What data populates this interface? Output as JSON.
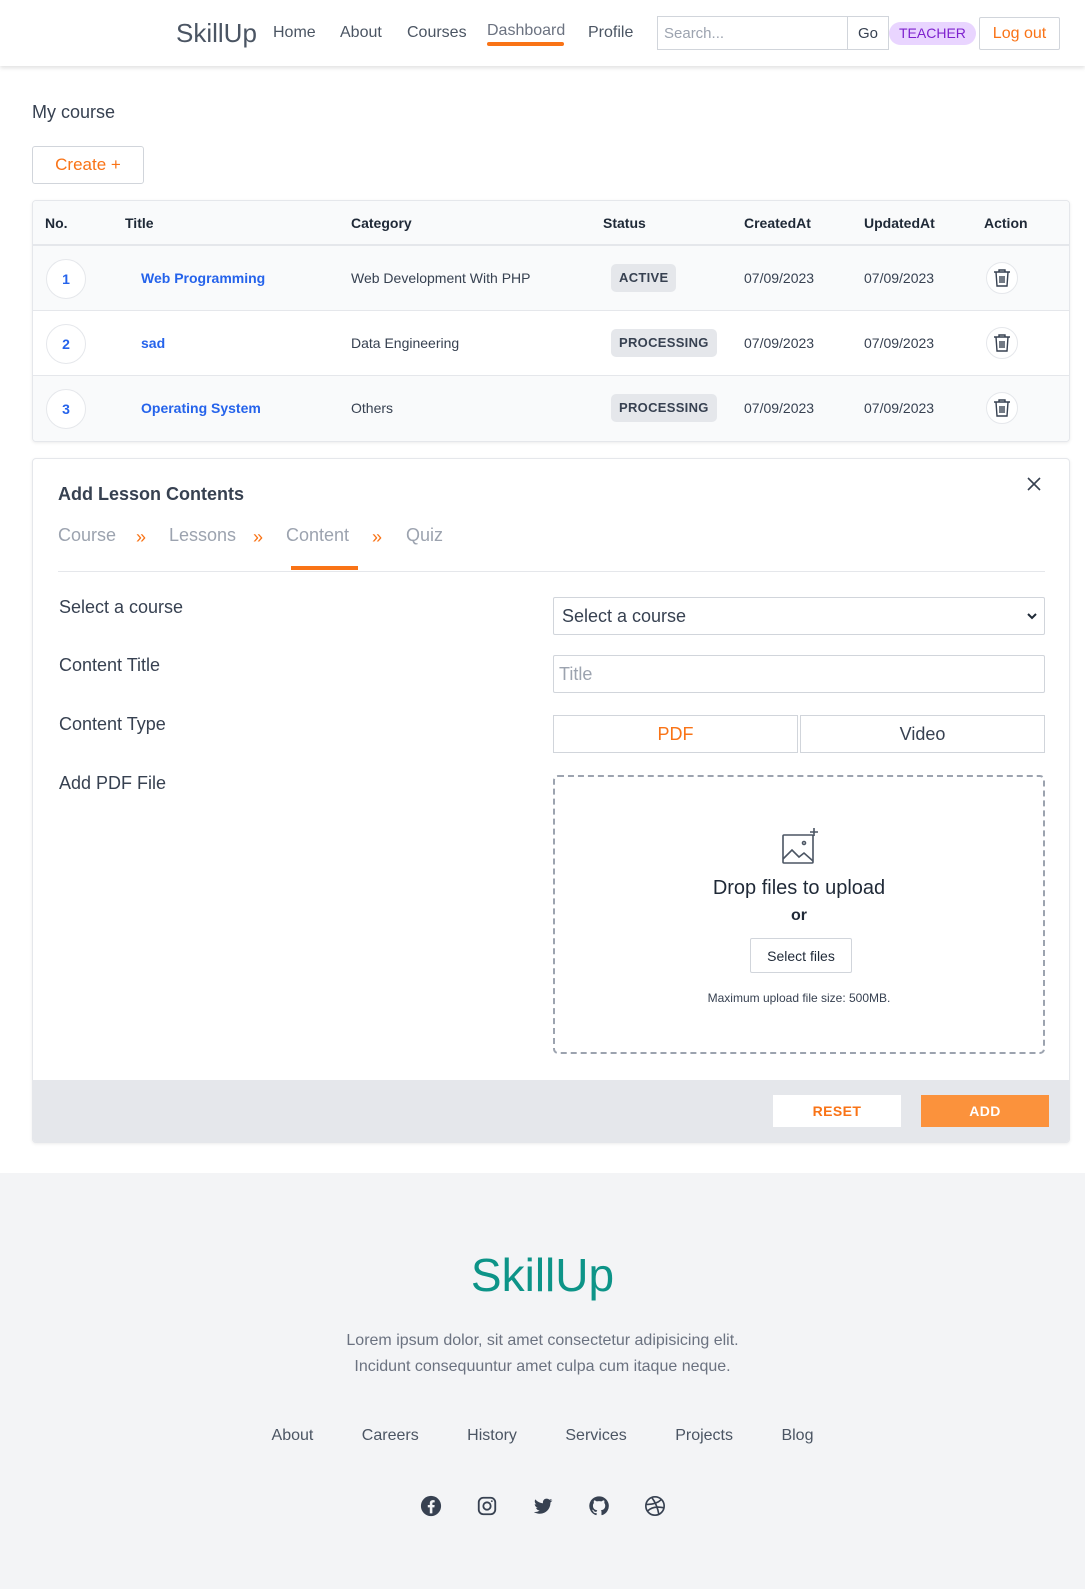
{
  "header": {
    "brand": "SkillUp",
    "nav": [
      "Home",
      "About",
      "Courses",
      "Dashboard",
      "Profile"
    ],
    "active_nav": "Dashboard",
    "search_placeholder": "Search...",
    "search_button": "Go",
    "role_badge": "TEACHER",
    "logout": "Log out"
  },
  "courses": {
    "title": "My course",
    "create_label": "Create +",
    "columns": [
      "No.",
      "Title",
      "Category",
      "Status",
      "CreatedAt",
      "UpdatedAt",
      "Action"
    ],
    "rows": [
      {
        "no": "1",
        "title": "Web Programming",
        "category": "Web Development With PHP",
        "status": "ACTIVE",
        "created": "07/09/2023",
        "updated": "07/09/2023"
      },
      {
        "no": "2",
        "title": "sad",
        "category": "Data Engineering",
        "status": "PROCESSING",
        "created": "07/09/2023",
        "updated": "07/09/2023"
      },
      {
        "no": "3",
        "title": "Operating System",
        "category": "Others",
        "status": "PROCESSING",
        "created": "07/09/2023",
        "updated": "07/09/2023"
      }
    ]
  },
  "lesson": {
    "title": "Add Lesson Contents",
    "steps": [
      "Course",
      "Lessons",
      "Content",
      "Quiz"
    ],
    "active_step": "Content",
    "step_separator": "»",
    "fields": {
      "course_label": "Select a course",
      "course_value": "Select a course",
      "content_title_label": "Content Title",
      "content_title_placeholder": "Title",
      "content_type_label": "Content Type",
      "type_options": [
        "PDF",
        "Video"
      ],
      "type_selected": "PDF",
      "pdf_label": "Add PDF File"
    },
    "dropzone": {
      "title": "Drop files to upload",
      "or": "or",
      "button": "Select files",
      "max_size": "Maximum upload file size: 500MB."
    },
    "reset": "RESET",
    "add": "ADD"
  },
  "footer": {
    "brand": "SkillUp",
    "desc_line1": "Lorem ipsum dolor, sit amet consectetur adipisicing elit.",
    "desc_line2": "Incidunt consequuntur amet culpa cum itaque neque.",
    "links": [
      "About",
      "Careers",
      "History",
      "Services",
      "Projects",
      "Blog"
    ],
    "social": [
      "facebook-icon",
      "instagram-icon",
      "twitter-icon",
      "github-icon",
      "dribbble-icon"
    ]
  },
  "colors": {
    "accent": "#f97316",
    "link": "#2563eb",
    "footer_brand": "#0d9488",
    "badge_bg": "#e9d5ff"
  }
}
